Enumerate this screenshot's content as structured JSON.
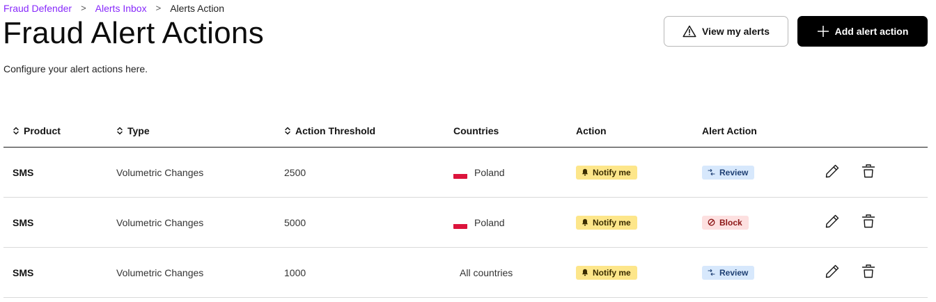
{
  "breadcrumb": {
    "items": [
      "Fraud Defender",
      "Alerts Inbox",
      "Alerts Action"
    ],
    "separator": ">"
  },
  "page": {
    "title": "Fraud Alert Actions",
    "description": "Configure your alert actions here."
  },
  "buttons": {
    "view_alerts": "View my alerts",
    "add_action": "Add alert action"
  },
  "table": {
    "columns": [
      "Product",
      "Type",
      "Action Threshold",
      "Countries",
      "Action",
      "Alert Action"
    ],
    "rows": [
      {
        "product": "SMS",
        "type": "Volumetric Changes",
        "threshold": "2500",
        "country": "Poland",
        "action": "Notify me",
        "alert_action": "Review"
      },
      {
        "product": "SMS",
        "type": "Volumetric Changes",
        "threshold": "5000",
        "country": "Poland",
        "action": "Notify me",
        "alert_action": "Block"
      },
      {
        "product": "SMS",
        "type": "Volumetric Changes",
        "threshold": "1000",
        "country": "All countries",
        "action": "Notify me",
        "alert_action": "Review"
      }
    ]
  },
  "colors": {
    "brand_link": "#8728fb",
    "primary_button": "#000000",
    "notify_badge": "#fde68a",
    "review_badge": "#d7e8fc",
    "block_badge": "#fde0e0"
  },
  "icons": {
    "sort": "sort-icon",
    "warning": "warning-icon",
    "plus": "plus-icon",
    "bell": "bell-icon",
    "review": "review-icon",
    "block": "block-icon",
    "edit": "pencil-icon",
    "delete": "trash-icon"
  }
}
